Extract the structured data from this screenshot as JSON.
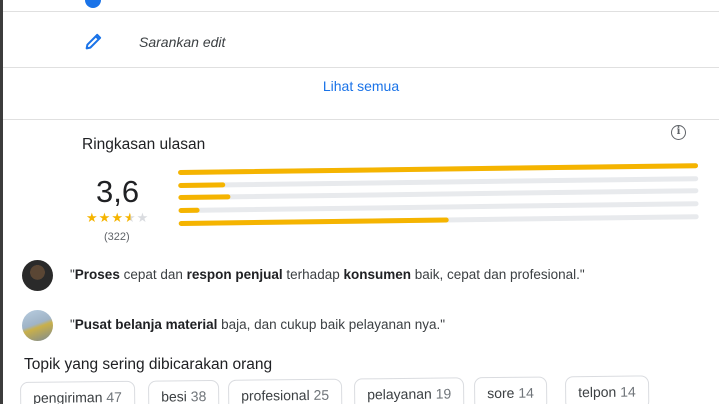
{
  "edit": {
    "label": "Sarankan edit"
  },
  "see_all": {
    "label": "Lihat semua"
  },
  "summary": {
    "title": "Ringkasan ulasan",
    "score": "3,6",
    "stars_value": 3.6,
    "review_count": "(322)",
    "distribution": [
      {
        "stars": 5,
        "fill": 1.0
      },
      {
        "stars": 4,
        "fill": 0.09
      },
      {
        "stars": 3,
        "fill": 0.1
      },
      {
        "stars": 2,
        "fill": 0.04
      },
      {
        "stars": 1,
        "fill": 0.52
      }
    ],
    "bar_color": "#f5b400"
  },
  "reviews": [
    {
      "parts": [
        {
          "t": "\"",
          "b": false
        },
        {
          "t": "Proses",
          "b": true
        },
        {
          "t": " cepat dan ",
          "b": false
        },
        {
          "t": "respon penjual",
          "b": true
        },
        {
          "t": " terhadap ",
          "b": false
        },
        {
          "t": "konsumen",
          "b": true
        },
        {
          "t": " baik, cepat dan profesional.\"",
          "b": false
        }
      ]
    },
    {
      "parts": [
        {
          "t": "\"",
          "b": false
        },
        {
          "t": "Pusat belanja material",
          "b": true
        },
        {
          "t": " baja, dan cukup baik pelayanan nya.\"",
          "b": false
        }
      ]
    }
  ],
  "topics": {
    "title": "Topik yang sering dibicarakan orang",
    "chips": [
      {
        "label": "pengiriman",
        "count": "47"
      },
      {
        "label": "besi",
        "count": "38"
      },
      {
        "label": "profesional",
        "count": "25"
      },
      {
        "label": "pelayanan",
        "count": "19"
      },
      {
        "label": "sore",
        "count": "14"
      },
      {
        "label": "telpon",
        "count": "14"
      }
    ]
  },
  "colors": {
    "accent": "#1a73e8",
    "star": "#f5b400"
  },
  "icons": {
    "edit": "pencil-icon",
    "info": "info-icon"
  }
}
